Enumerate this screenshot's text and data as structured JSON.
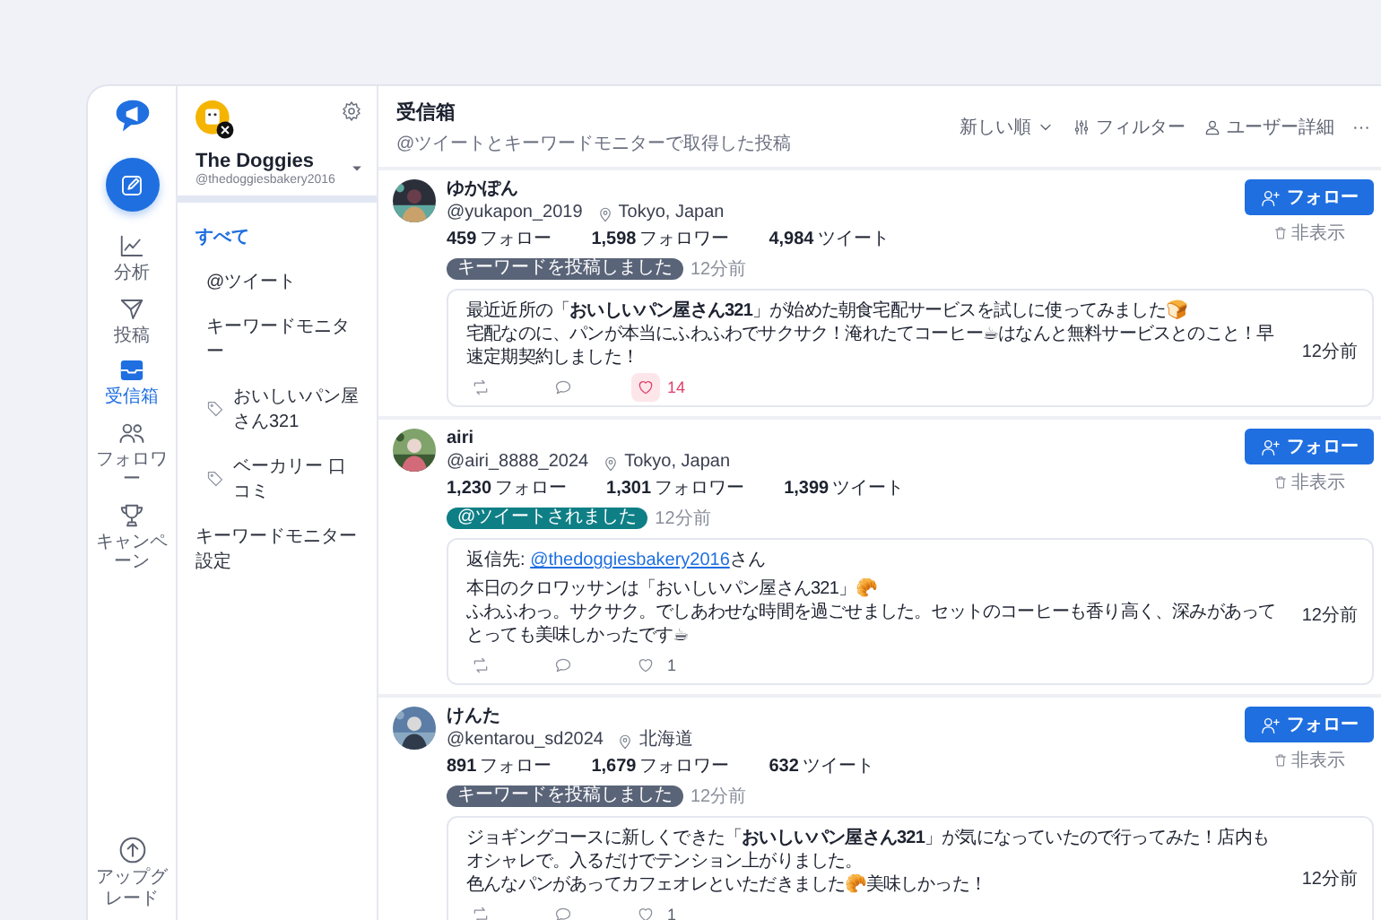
{
  "rail": {
    "items": [
      {
        "kind": "chart",
        "label": "分析",
        "selected": false
      },
      {
        "kind": "send",
        "label": "投稿",
        "selected": false
      },
      {
        "kind": "inbox",
        "label": "受信箱",
        "selected": true
      },
      {
        "kind": "people",
        "label": "フォロワー",
        "selected": false
      },
      {
        "kind": "trophy",
        "label": "キャンペーン",
        "selected": false
      }
    ],
    "upgrade": {
      "label": "アップグレード"
    }
  },
  "account": {
    "name": "The Doggies",
    "handle": "@thedoggiesbakery2016"
  },
  "sidebar": {
    "items": [
      {
        "kind": "link",
        "label": "すべて",
        "selected": true
      },
      {
        "kind": "item",
        "label": "@ツイート",
        "selected": false
      },
      {
        "kind": "item",
        "label": "キーワードモニター",
        "selected": false,
        "children": [
          {
            "kind": "tag",
            "label": "おいしいパン屋さん321",
            "selected": false
          },
          {
            "kind": "tag",
            "label": "ベーカリー 口コミ",
            "selected": false
          }
        ]
      },
      {
        "kind": "link",
        "label": "キーワードモニター設定",
        "selected": false
      }
    ]
  },
  "header": {
    "title": "受信箱",
    "subtitle": "@ツイートとキーワードモニターで取得した投稿",
    "actions": [
      {
        "kind": "sort",
        "label": "新しい順"
      },
      {
        "kind": "filter",
        "label": "フィルター"
      },
      {
        "kind": "user",
        "label": "ユーザー詳細"
      },
      {
        "kind": "more",
        "label": "···"
      }
    ]
  },
  "posts": [
    {
      "name": "ゆかぽん",
      "handle": "@yukapon_2019",
      "location": "Tokyo, Japan",
      "stats": [
        {
          "value": "459",
          "label": "フォロー"
        },
        {
          "value": "1,598",
          "label": "フォロワー"
        },
        {
          "value": "4,984",
          "label": "ツイート"
        }
      ],
      "badge": {
        "kind": "keyword",
        "label": "キーワードを投稿しました"
      },
      "badge_time": "12分前",
      "follow": "フォロー",
      "hide": "非表示",
      "lines": [
        "最近近所の「**おいしいパン屋さん321**」が始めた朝食宅配サービスを試しに使ってみました🍞",
        "宅配なのに、パンが本当にふわふわでサクサク！淹れたてコーヒー☕はなんと無料サービスとのこと！早速定期契約しました！"
      ],
      "likes": "14",
      "liked": true,
      "time": "12分前"
    },
    {
      "name": "airi",
      "handle": "@airi_8888_2024",
      "location": "Tokyo, Japan",
      "stats": [
        {
          "value": "1,230",
          "label": "フォロー"
        },
        {
          "value": "1,301",
          "label": "フォロワー"
        },
        {
          "value": "1,399",
          "label": "ツイート"
        }
      ],
      "badge": {
        "kind": "mention",
        "label": "@ツイートされました"
      },
      "badge_time": "12分前",
      "follow": "フォロー",
      "hide": "非表示",
      "reply_to": {
        "prefix": "返信先: ",
        "handle": "@thedoggiesbakery2016",
        "suffix": "さん"
      },
      "lines": [
        "本日のクロワッサンは「おいしいパン屋さん321」🥐",
        "ふわふわっ。サクサク。でしあわせな時間を過ごせました。セットのコーヒーも香り高く、深みがあってとっても美味しかったです☕"
      ],
      "likes": "1",
      "liked": false,
      "time": "12分前"
    },
    {
      "name": "けんた",
      "handle": "@kentarou_sd2024",
      "location": "北海道",
      "stats": [
        {
          "value": "891",
          "label": "フォロー"
        },
        {
          "value": "1,679",
          "label": "フォロワー"
        },
        {
          "value": "632",
          "label": "ツイート"
        }
      ],
      "badge": {
        "kind": "keyword",
        "label": "キーワードを投稿しました"
      },
      "badge_time": "12分前",
      "follow": "フォロー",
      "hide": "非表示",
      "lines": [
        "ジョギングコースに新しくできた「**おいしいパン屋さん321**」が気になっていたので行ってみた！店内もオシャレで。入るだけでテンション上がりました。",
        "色んなパンがあってカフェオレといただきました🥐美味しかった！"
      ],
      "likes": "1",
      "liked": false,
      "time": "12分前"
    }
  ]
}
